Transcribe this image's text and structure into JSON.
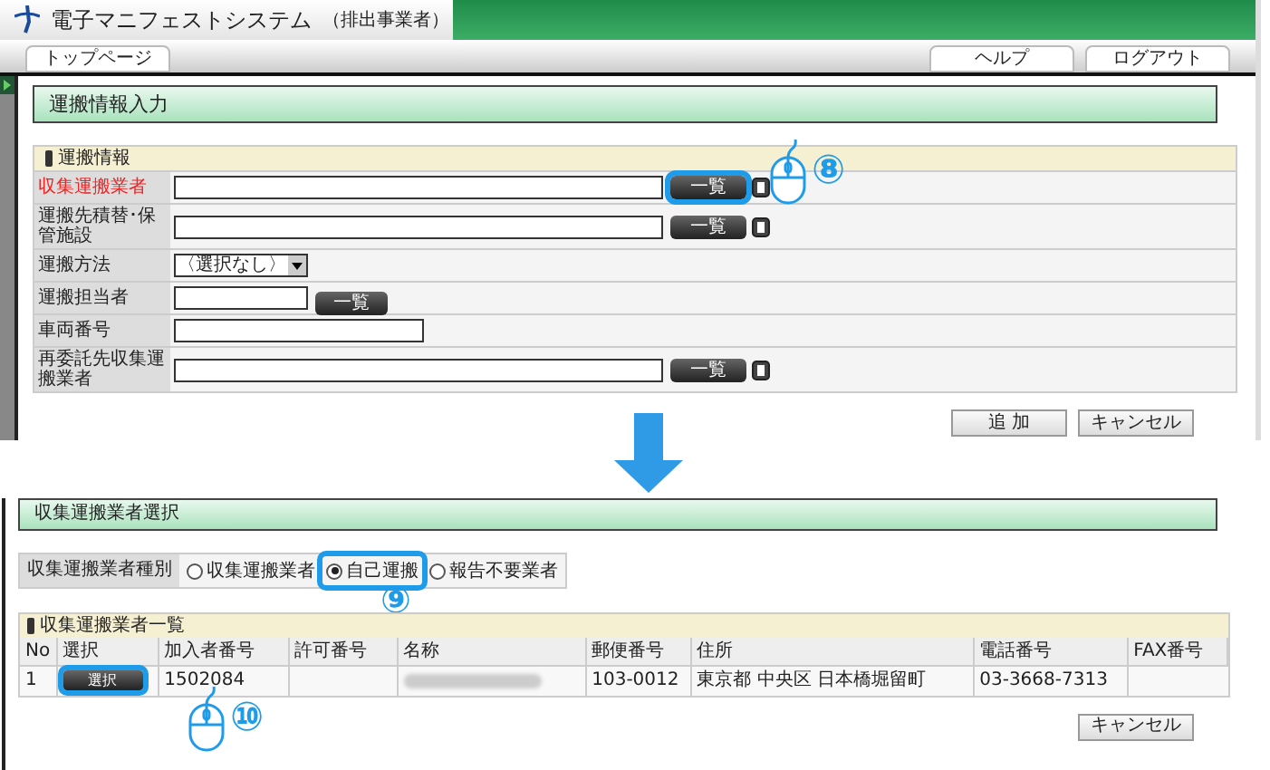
{
  "header": {
    "title": "電子マニフェストシステム",
    "subtitle": "（排出事業者）"
  },
  "nav": {
    "left": [
      "トップページ"
    ],
    "right": [
      "ヘルプ",
      "ログアウト"
    ]
  },
  "form_screen": {
    "heading": "運搬情報入力",
    "panel_title": "運搬情報",
    "rows": [
      {
        "label": "収集運搬業者",
        "required": true,
        "kind": "lookup",
        "button": "一覧",
        "highlighted": true,
        "callout": "⑧"
      },
      {
        "label": "運搬先積替･保管施設",
        "required": false,
        "kind": "lookup",
        "button": "一覧",
        "highlighted": false
      },
      {
        "label": "運搬方法",
        "required": false,
        "kind": "select",
        "value": "〈選択なし〉"
      },
      {
        "label": "運搬担当者",
        "required": false,
        "kind": "short-lookup",
        "button": "一覧",
        "highlighted": false
      },
      {
        "label": "車両番号",
        "required": false,
        "kind": "text"
      },
      {
        "label": "再委託先収集運搬業者",
        "required": false,
        "kind": "lookup",
        "button": "一覧",
        "highlighted": false
      }
    ],
    "buttons": [
      "追 加",
      "キャンセル"
    ]
  },
  "selection_screen": {
    "heading": "収集運搬業者選択",
    "type_label": "収集運搬業者種別",
    "options": [
      {
        "label": "収集運搬業者",
        "selected": false
      },
      {
        "label": "自己運搬",
        "selected": true
      },
      {
        "label": "報告不要業者",
        "selected": false
      }
    ],
    "options_callout": "⑨",
    "list_title": "収集運搬業者一覧",
    "columns": [
      "No",
      "選択",
      "加入者番号",
      "許可番号",
      "名称",
      "郵便番号",
      "住所",
      "電話番号",
      "FAX番号"
    ],
    "rows": [
      {
        "no": "1",
        "button": "選択",
        "highlighted": true,
        "member_no": "1502084",
        "name_redacted": true,
        "postal": "103-0012",
        "address": "東京都 中央区 日本橋堀留町",
        "phone": "03-3668-7313"
      }
    ],
    "rows_callout": "⑩",
    "cancel": "キャンセル"
  }
}
